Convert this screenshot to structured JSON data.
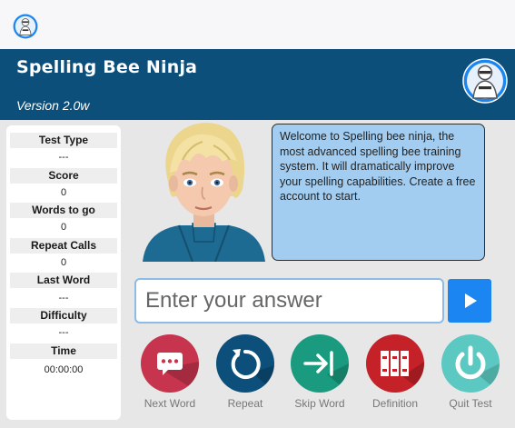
{
  "app": {
    "title": "Spelling Bee Ninja",
    "version": "Version 2.0w"
  },
  "stats": [
    {
      "label": "Test Type",
      "value": "---"
    },
    {
      "label": "Score",
      "value": "0"
    },
    {
      "label": "Words to go",
      "value": "0"
    },
    {
      "label": "Repeat Calls",
      "value": "0"
    },
    {
      "label": "Last Word",
      "value": "---"
    },
    {
      "label": "Difficulty",
      "value": "---"
    },
    {
      "label": "Time",
      "value": "00:00:00"
    }
  ],
  "welcome": {
    "message": "Welcome to Spelling bee ninja, the most advanced spelling bee training system. It will dramatically improve your spelling capabilities. Create a free account to start."
  },
  "answer": {
    "placeholder": "Enter your answer",
    "value": ""
  },
  "actions": [
    {
      "label": "Next Word",
      "color": "#c7344d",
      "icon": "chat-bubble-icon"
    },
    {
      "label": "Repeat",
      "color": "#0c4f7a",
      "icon": "repeat-icon"
    },
    {
      "label": "Skip Word",
      "color": "#1a9a7e",
      "icon": "skip-icon"
    },
    {
      "label": "Definition",
      "color": "#c42128",
      "icon": "books-icon"
    },
    {
      "label": "Quit Test",
      "color": "#5bc9c1",
      "icon": "power-icon"
    }
  ],
  "colors": {
    "header": "#0c4f7a",
    "speech_bubble": "#a3cdf0",
    "submit": "#1b86f1"
  }
}
